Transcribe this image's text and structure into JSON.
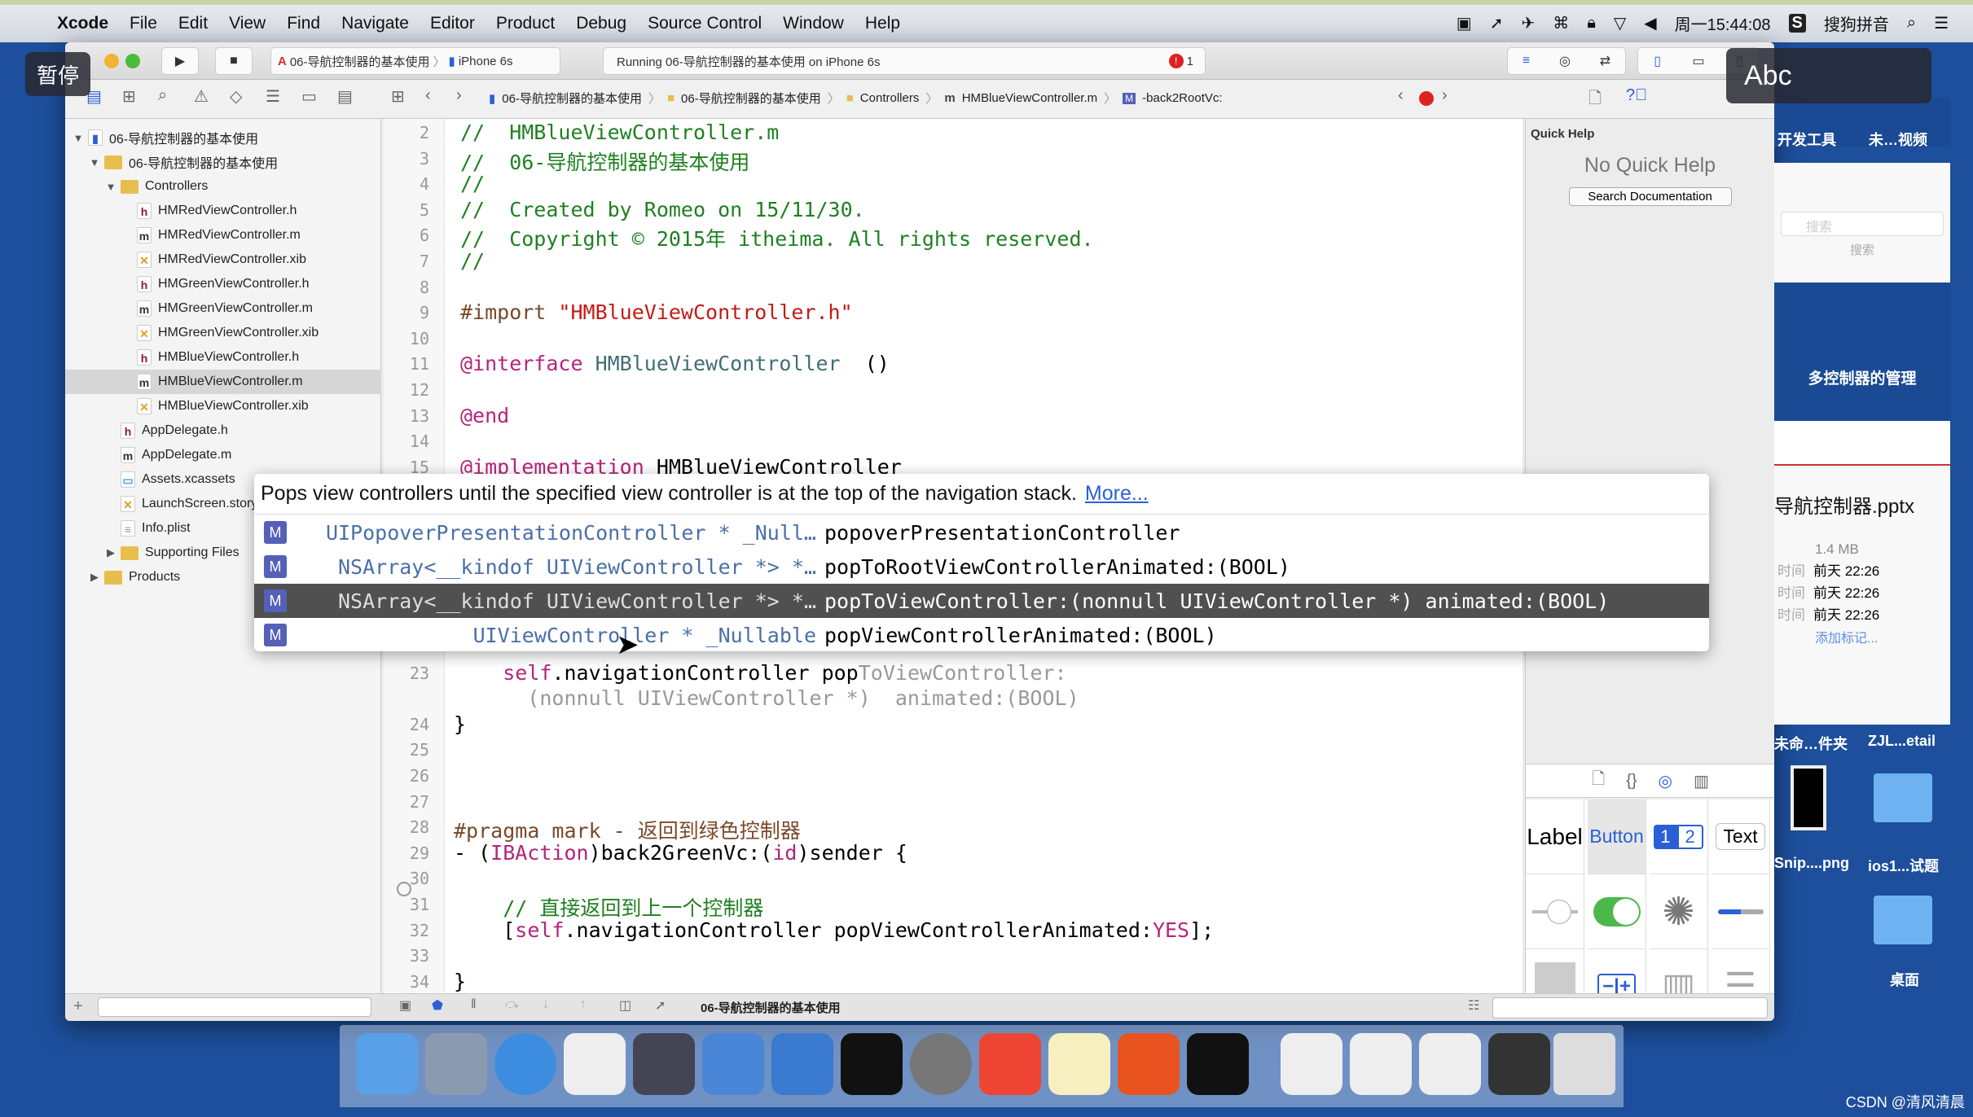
{
  "menubar": {
    "items": [
      "Xcode",
      "File",
      "Edit",
      "View",
      "Find",
      "Navigate",
      "Editor",
      "Product",
      "Debug",
      "Source Control",
      "Window",
      "Help"
    ],
    "clock": "周一15:44:08",
    "ime": "搜狗拼音"
  },
  "overlays": {
    "pause": "暂停",
    "abc": "Abc"
  },
  "toolbar": {
    "scheme": "06-导航控制器的基本使用",
    "device": "iPhone 6s",
    "activity": "Running 06-导航控制器的基本使用 on iPhone 6s",
    "error_count": "1"
  },
  "jumpbar": [
    "06-导航控制器的基本使用",
    "06-导航控制器的基本使用",
    "Controllers",
    "HMBlueViewController.m",
    "-back2RootVc:"
  ],
  "navigator": {
    "items": [
      {
        "label": "06-导航控制器的基本使用",
        "type": "project",
        "depth": 0,
        "open": true
      },
      {
        "label": "06-导航控制器的基本使用",
        "type": "folder",
        "depth": 1,
        "open": true
      },
      {
        "label": "Controllers",
        "type": "folder",
        "depth": 2,
        "open": true
      },
      {
        "label": "HMRedViewController.h",
        "type": "h",
        "depth": 3
      },
      {
        "label": "HMRedViewController.m",
        "type": "m",
        "depth": 3
      },
      {
        "label": "HMRedViewController.xib",
        "type": "xib",
        "depth": 3
      },
      {
        "label": "HMGreenViewController.h",
        "type": "h",
        "depth": 3
      },
      {
        "label": "HMGreenViewController.m",
        "type": "m",
        "depth": 3
      },
      {
        "label": "HMGreenViewController.xib",
        "type": "xib",
        "depth": 3
      },
      {
        "label": "HMBlueViewController.h",
        "type": "h",
        "depth": 3
      },
      {
        "label": "HMBlueViewController.m",
        "type": "m",
        "depth": 3,
        "selected": true
      },
      {
        "label": "HMBlueViewController.xib",
        "type": "xib",
        "depth": 3
      },
      {
        "label": "AppDelegate.h",
        "type": "h",
        "depth": 2
      },
      {
        "label": "AppDelegate.m",
        "type": "m",
        "depth": 2
      },
      {
        "label": "Assets.xcassets",
        "type": "assets",
        "depth": 2
      },
      {
        "label": "LaunchScreen.storyboard",
        "type": "xib",
        "depth": 2
      },
      {
        "label": "Info.plist",
        "type": "plist",
        "depth": 2
      },
      {
        "label": "Supporting Files",
        "type": "folder",
        "depth": 2,
        "open": false
      },
      {
        "label": "Products",
        "type": "folder",
        "depth": 1,
        "open": false
      }
    ]
  },
  "code": [
    {
      "n": "2",
      "y": 0,
      "segs": [
        [
          "c-com",
          "//  HMBlueViewController.m"
        ]
      ]
    },
    {
      "n": "3",
      "y": 1,
      "segs": [
        [
          "c-com",
          "//  06-导航控制器的基本使用"
        ]
      ]
    },
    {
      "n": "4",
      "y": 2,
      "segs": [
        [
          "c-com",
          "//"
        ]
      ]
    },
    {
      "n": "5",
      "y": 3,
      "segs": [
        [
          "c-com",
          "//  Created by Romeo on 15/11/30."
        ]
      ]
    },
    {
      "n": "6",
      "y": 4,
      "segs": [
        [
          "c-com",
          "//  Copyright © 2015年 itheima. All rights reserved."
        ]
      ]
    },
    {
      "n": "7",
      "y": 5,
      "segs": [
        [
          "c-com",
          "//"
        ]
      ]
    },
    {
      "n": "8",
      "y": 6,
      "segs": []
    },
    {
      "n": "9",
      "y": 7,
      "segs": [
        [
          "c-pre",
          "#import "
        ],
        [
          "c-str",
          "\"HMBlueViewController.h\""
        ]
      ]
    },
    {
      "n": "10",
      "y": 8,
      "segs": []
    },
    {
      "n": "11",
      "y": 9,
      "segs": [
        [
          "c-kw",
          "@interface "
        ],
        [
          "c-cls",
          "HMBlueViewController"
        ],
        [
          "",
          "  ()"
        ]
      ]
    },
    {
      "n": "12",
      "y": 10,
      "segs": []
    },
    {
      "n": "13",
      "y": 11,
      "segs": [
        [
          "c-kw",
          "@end"
        ]
      ]
    },
    {
      "n": "14",
      "y": 12,
      "segs": []
    },
    {
      "n": "15",
      "y": 13,
      "segs": [
        [
          "c-kw",
          "@implementation "
        ],
        [
          "",
          "HMBlueViewController"
        ]
      ]
    },
    {
      "n": "23",
      "y": 21,
      "segs": [
        [
          "",
          "    "
        ],
        [
          "c-kw",
          "self"
        ],
        [
          "",
          ".navigationController pop"
        ],
        [
          "c-ph",
          "ToViewController:"
        ]
      ]
    },
    {
      "n": "",
      "y": 22,
      "segs": [
        [
          "c-ph",
          "      (nonnull UIViewController *)  animated:(BOOL)"
        ]
      ]
    },
    {
      "n": "24",
      "y": 23,
      "segs": [
        [
          "",
          "}"
        ]
      ]
    },
    {
      "n": "25",
      "y": 24,
      "segs": []
    },
    {
      "n": "26",
      "y": 25,
      "segs": []
    },
    {
      "n": "27",
      "y": 26,
      "segs": []
    },
    {
      "n": "28",
      "y": 27,
      "segs": [
        [
          "c-pre",
          "#pragma mark - 返回到绿色控制器"
        ]
      ]
    },
    {
      "n": "29",
      "y": 28,
      "segs": [
        [
          "",
          "- ("
        ],
        [
          "c-kw",
          "IBAction"
        ],
        [
          "",
          ")back2GreenVc:("
        ],
        [
          "c-kw",
          "id"
        ],
        [
          "",
          ")sender {"
        ]
      ]
    },
    {
      "n": "30",
      "y": 29,
      "segs": []
    },
    {
      "n": "31",
      "y": 30,
      "segs": [
        [
          "",
          "    "
        ],
        [
          "c-com",
          "// 直接返回到上一个控制器"
        ]
      ]
    },
    {
      "n": "32",
      "y": 31,
      "segs": [
        [
          "",
          "    ["
        ],
        [
          "c-kw",
          "self"
        ],
        [
          "",
          ".navigationController popViewControllerAnimated:"
        ],
        [
          "c-kw",
          "YES"
        ],
        [
          "",
          "];"
        ]
      ]
    },
    {
      "n": "33",
      "y": 32,
      "segs": []
    },
    {
      "n": "34",
      "y": 33,
      "segs": [
        [
          "",
          "}"
        ]
      ]
    }
  ],
  "completion": {
    "description": "Pops view controllers until the specified view controller is at the top of the navigation stack.",
    "more_link": "More...",
    "items": [
      {
        "kind": "M",
        "return_type": "UIPopoverPresentationController * _Null…",
        "signature": "popoverPresentationController"
      },
      {
        "kind": "M",
        "return_type": "NSArray<__kindof UIViewController *> *…",
        "signature": "popToRootViewControllerAnimated:(BOOL)"
      },
      {
        "kind": "M",
        "return_type": "NSArray<__kindof UIViewController *> *…",
        "signature": "popToViewController:(nonnull UIViewController *) animated:(BOOL)",
        "selected": true
      },
      {
        "kind": "M",
        "return_type": "UIViewController * _Nullable",
        "signature": "popViewControllerAnimated:(BOOL)"
      }
    ]
  },
  "inspector": {
    "title": "Quick Help",
    "empty": "No Quick Help",
    "search_button": "Search Documentation"
  },
  "library": {
    "items": [
      "Label",
      "Button",
      "1",
      "2",
      "Text"
    ]
  },
  "debugbar": {
    "target": "06-导航控制器的基本使用"
  },
  "finder": {
    "tags": [
      "开发工具",
      "未…视频"
    ],
    "search_placeholder": "搜索",
    "search_label": "搜索",
    "preview_title": "多控制器的管理",
    "file_name": "导航控制器.pptx",
    "size": "1.4 MB",
    "dates": [
      {
        "label": "时间",
        "value": "前天 22:26"
      },
      {
        "label": "时间",
        "value": "前天 22:26"
      },
      {
        "label": "时间",
        "value": "前天 22:26"
      }
    ],
    "add_tag": "添加标记...",
    "desktop_items": [
      "未命…件夹",
      "ZJL...etail",
      "Snip....png",
      "ios1...试题",
      "桌面"
    ]
  },
  "watermark": "CSDN @清风清晨",
  "colors": {
    "accent": "#2f6fe0",
    "desktop": "#1d4f9c",
    "highlight_row": "#505050"
  }
}
